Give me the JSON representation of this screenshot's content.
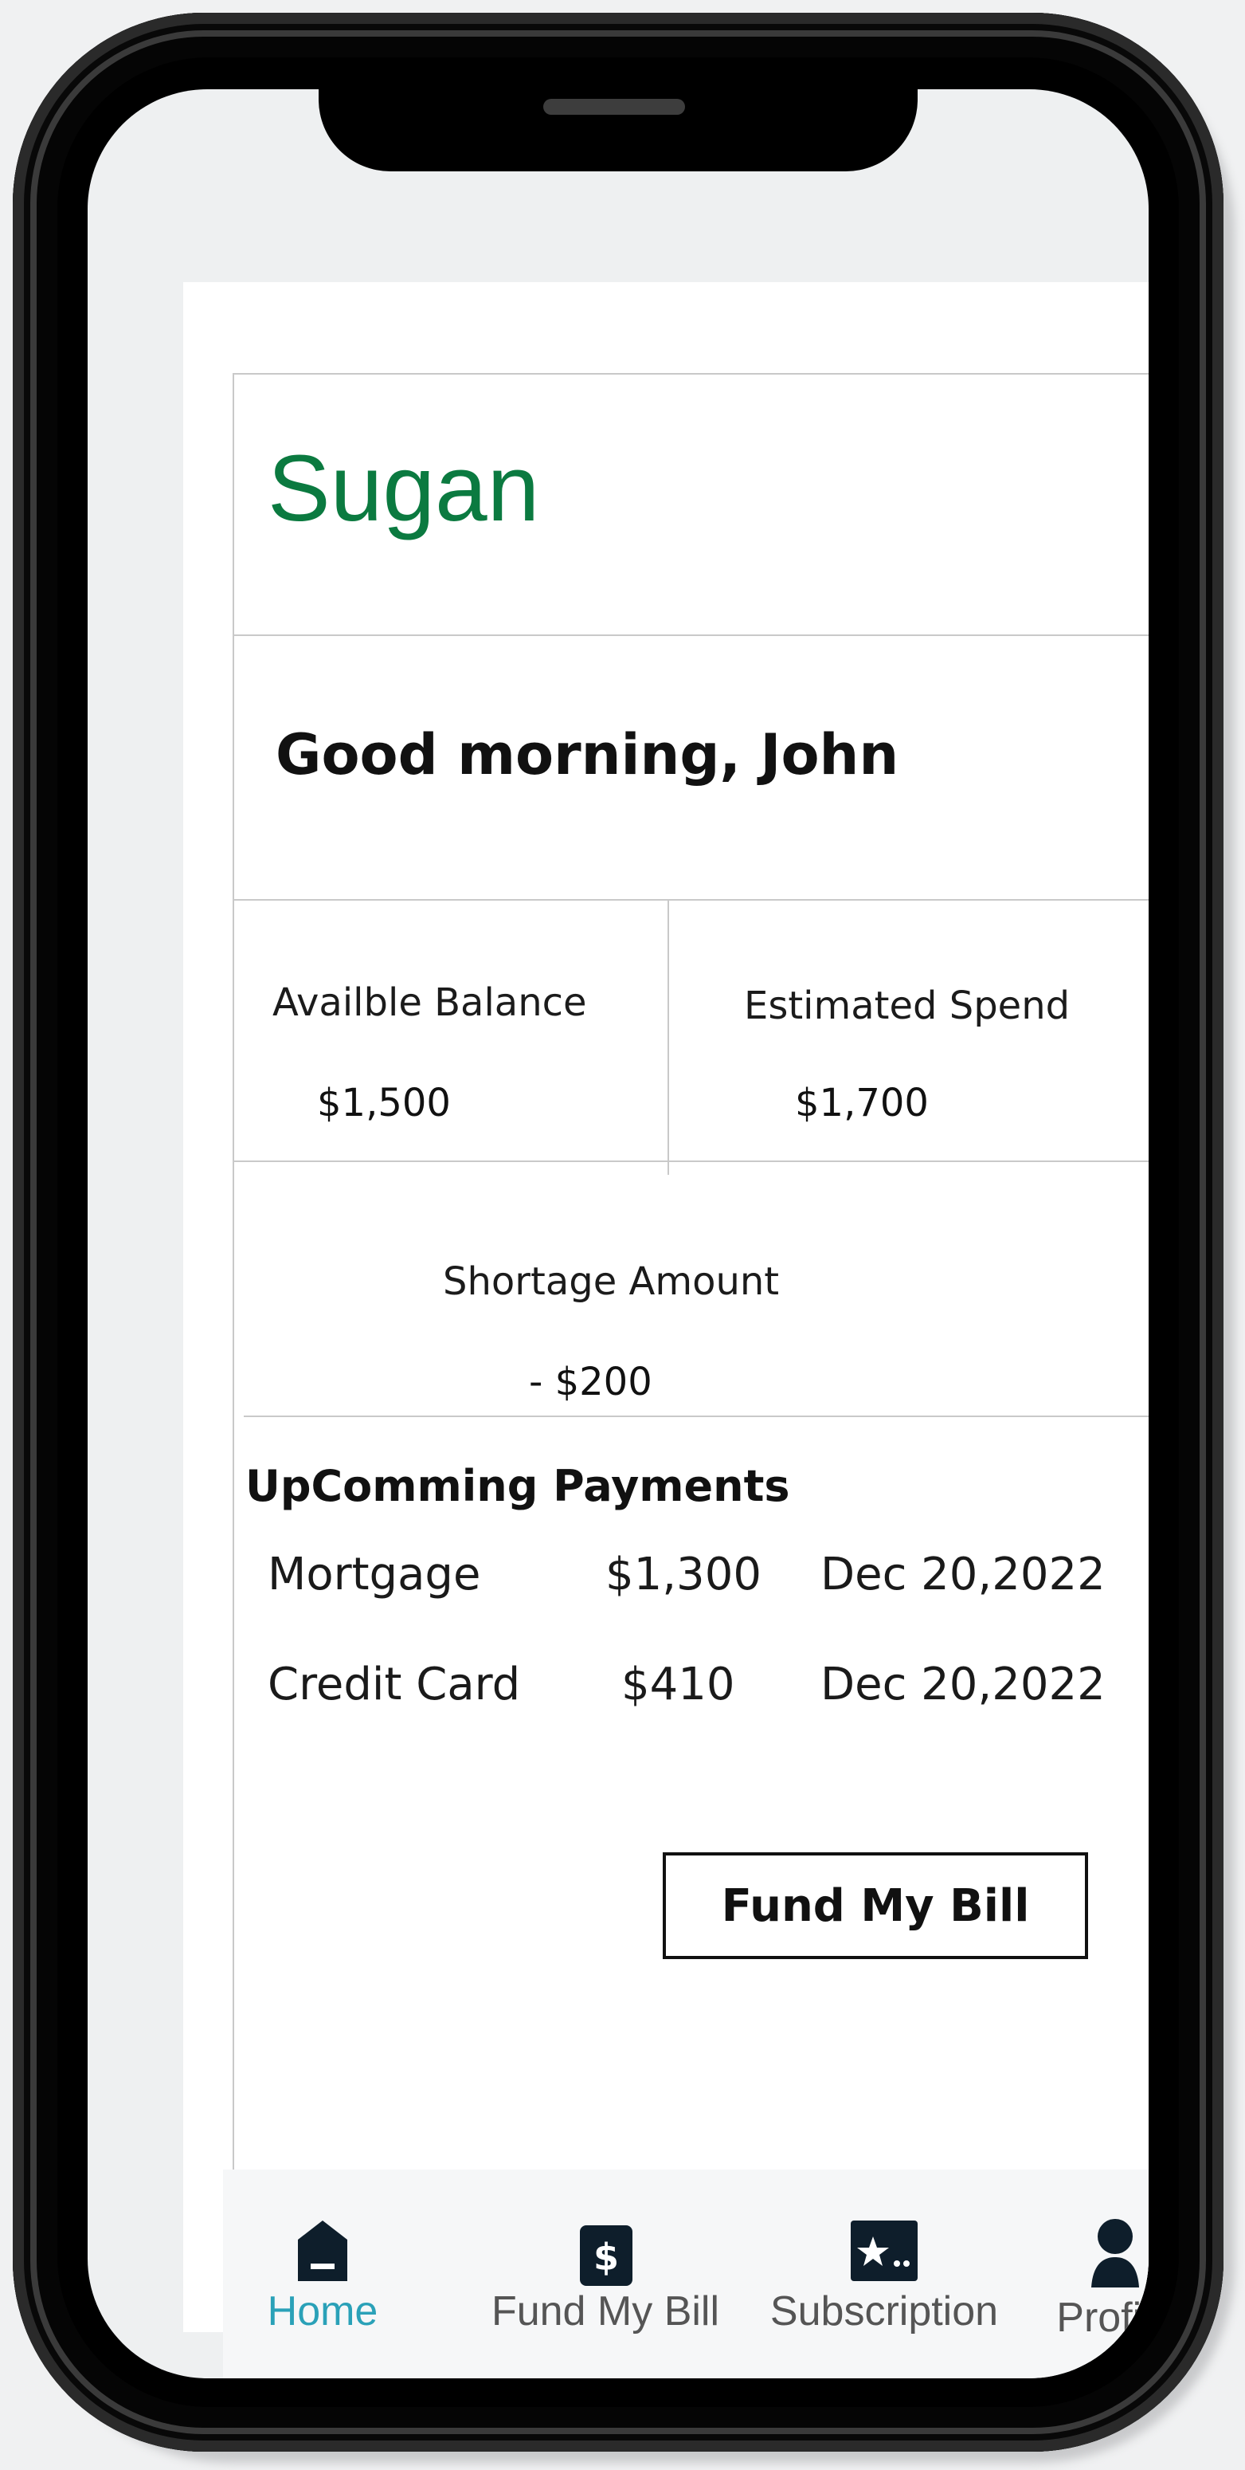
{
  "app": {
    "brand": "Sugan"
  },
  "greeting": "Good morning, John",
  "balance": {
    "available_label": "Availble Balance",
    "available_value": "$1,500",
    "estimated_label": "Estimated Spend",
    "estimated_value": "$1,700"
  },
  "shortage": {
    "label": "Shortage Amount",
    "value": "- $200"
  },
  "upcoming": {
    "title": "UpComming Payments",
    "rows": [
      {
        "name": "Mortgage",
        "amount": "$1,300",
        "date": "Dec 20,2022"
      },
      {
        "name": "Credit Card",
        "amount": "$410",
        "date": "Dec 20,2022"
      }
    ]
  },
  "actions": {
    "fund_button": "Fund My Bill"
  },
  "nav": {
    "items": [
      {
        "label": "Home",
        "icon": "home-icon",
        "active": true
      },
      {
        "label": "Fund My Bill",
        "icon": "dollar-icon",
        "active": false
      },
      {
        "label": "Subscription",
        "icon": "subscription-star-icon",
        "active": false
      },
      {
        "label": "Profile",
        "icon": "person-icon",
        "active": false
      }
    ]
  },
  "colors": {
    "brand": "#0b7a40",
    "nav_active": "#2aa1b8",
    "nav_icon": "#0e1e2b"
  }
}
